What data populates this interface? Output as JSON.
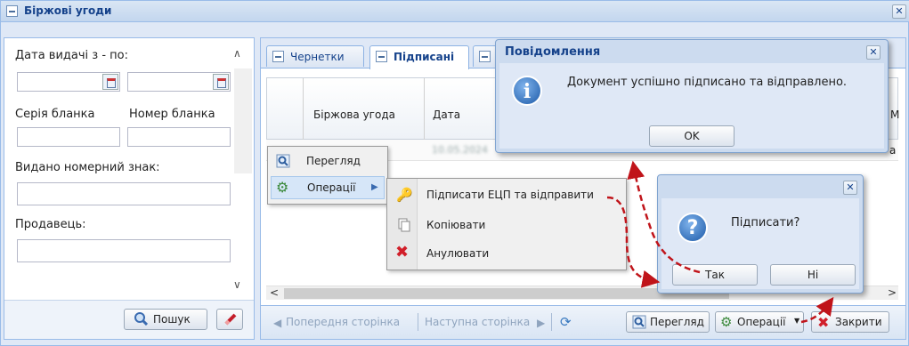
{
  "window": {
    "title": "Біржові угоди"
  },
  "filters": {
    "date_label": "Дата видачі з - по:",
    "series_label": "Серія бланка",
    "number_label": "Номер бланка",
    "sign_label": "Видано номерний знак:",
    "seller_label": "Продавець:",
    "search_button": "Пошук"
  },
  "tabs": [
    {
      "label": "Чернетки"
    },
    {
      "label": "Підписані"
    }
  ],
  "grid": {
    "columns": [
      "Біржова угода",
      "Дата"
    ],
    "row1_date": "10.05.2024",
    "right_cut_header": "М",
    "right_cut_cell": "а"
  },
  "toolbar": {
    "prev_page": "Попередня сторінка",
    "next_page": "Наступна сторінка",
    "view": "Перегляд",
    "operations": "Операції",
    "close": "Закрити"
  },
  "context_menu": {
    "items": [
      {
        "label": "Перегляд"
      },
      {
        "label": "Операції"
      }
    ],
    "submenu": [
      {
        "label": "Підписати ЕЦП та відправити"
      },
      {
        "label": "Копіювати"
      },
      {
        "label": "Анулювати"
      }
    ]
  },
  "message_dialog": {
    "title": "Повідомлення",
    "text": "Документ успішно підписано та відправлено.",
    "ok": "OK"
  },
  "confirm_dialog": {
    "text": "Підписати?",
    "yes": "Так",
    "no": "Ні"
  },
  "colors": {
    "accent": "#15428b",
    "arrow": "#c0141a",
    "panel": "#dfe8f6"
  }
}
